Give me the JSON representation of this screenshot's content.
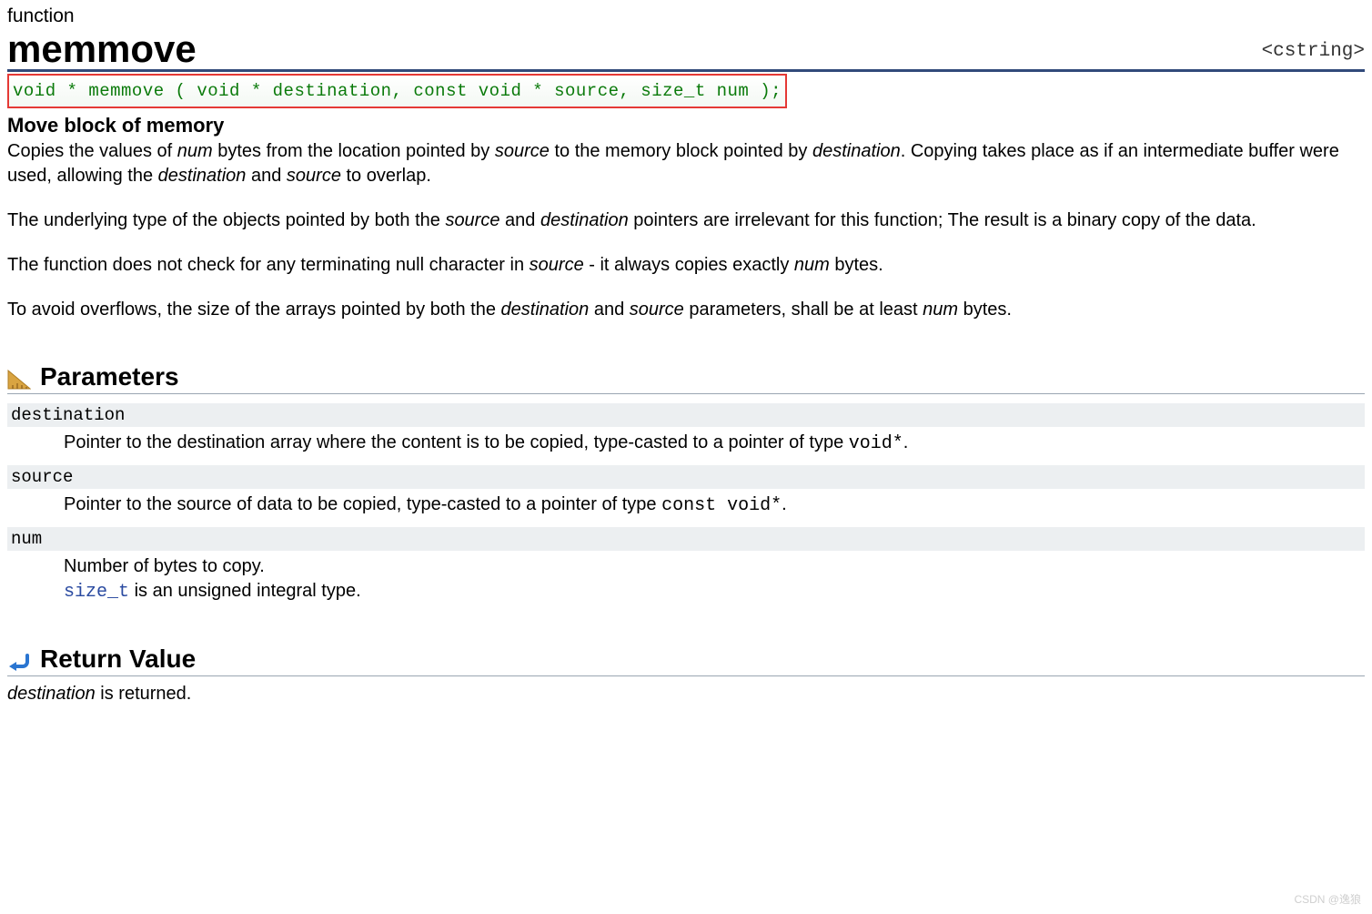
{
  "kind": "function",
  "title": "memmove",
  "header_include": "<cstring>",
  "signature": "void * memmove ( void * destination, const void * source, size_t num );",
  "summary_heading": "Move block of memory",
  "body": {
    "p1_pre": "Copies the values of ",
    "p1_num": "num",
    "p1_mid1": " bytes from the location pointed by ",
    "p1_source": "source",
    "p1_mid2": " to the memory block pointed by ",
    "p1_dest": "destination",
    "p1_mid3": ". Copying takes place as if an intermediate buffer were used, allowing the ",
    "p1_dest2": "destination",
    "p1_mid4": " and ",
    "p1_source2": "source",
    "p1_end": " to overlap.",
    "p2_pre": "The underlying type of the objects pointed by both the ",
    "p2_source": "source",
    "p2_mid1": " and ",
    "p2_dest": "destination",
    "p2_end": " pointers are irrelevant for this function; The result is a binary copy of the data.",
    "p3_pre": "The function does not check for any terminating null character in ",
    "p3_source": "source",
    "p3_mid": " - it always copies exactly ",
    "p3_num": "num",
    "p3_end": " bytes.",
    "p4_pre": "To avoid overflows, the size of the arrays pointed by both the ",
    "p4_dest": "destination",
    "p4_mid1": " and ",
    "p4_source": "source",
    "p4_mid2": " parameters, shall be at least ",
    "p4_num": "num",
    "p4_end": " bytes."
  },
  "sections": {
    "parameters": "Parameters",
    "return_value": "Return Value"
  },
  "params": {
    "destination": {
      "name": "destination",
      "desc_pre": "Pointer to the destination array where the content is to be copied, type-casted to a pointer of type ",
      "desc_type": "void*",
      "desc_end": "."
    },
    "source": {
      "name": "source",
      "desc_pre": "Pointer to the source of data to be copied, type-casted to a pointer of type ",
      "desc_type": "const void*",
      "desc_end": "."
    },
    "num": {
      "name": "num",
      "desc_line1": "Number of bytes to copy.",
      "desc_type": "size_t",
      "desc_line2": " is an unsigned integral type."
    }
  },
  "return": {
    "dest": "destination",
    "text": " is returned."
  },
  "watermark": "CSDN @逸狼"
}
